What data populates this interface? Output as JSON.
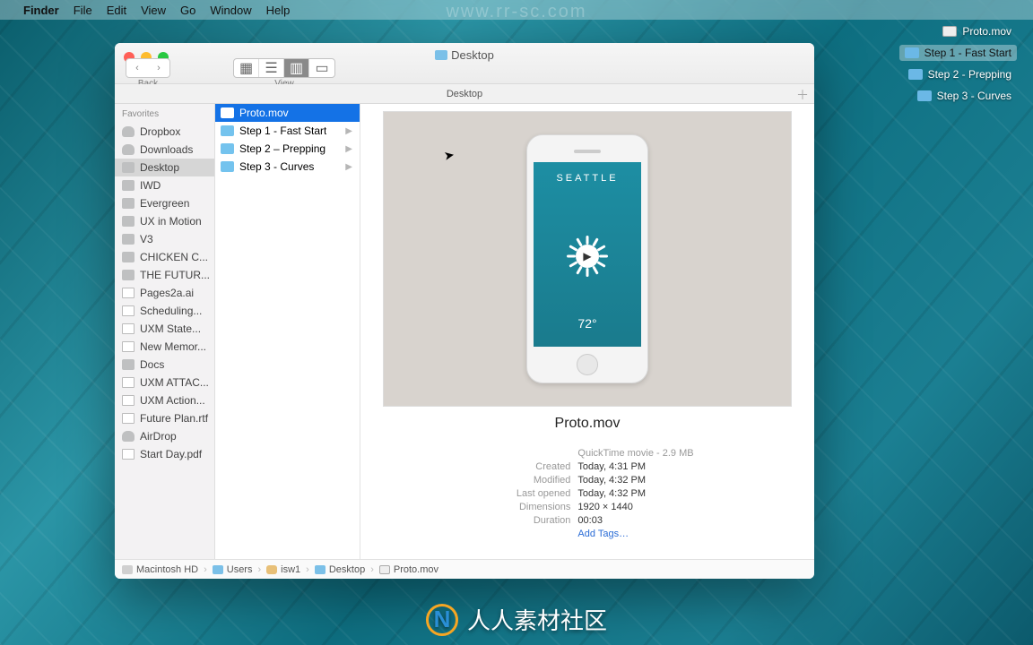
{
  "menubar": {
    "app": "Finder",
    "items": [
      "File",
      "Edit",
      "View",
      "Go",
      "Window",
      "Help"
    ]
  },
  "desktop_icons": [
    {
      "label": "Proto.mov",
      "type": "mov",
      "selected": false
    },
    {
      "label": "Step 1 - Fast Start",
      "type": "fld",
      "selected": true
    },
    {
      "label": "Step 2 - Prepping",
      "type": "fld",
      "selected": false
    },
    {
      "label": "Step 3 - Curves",
      "type": "fld",
      "selected": false
    }
  ],
  "window": {
    "title": "Desktop",
    "back_label": "Back",
    "view_label": "View",
    "tab": "Desktop"
  },
  "sidebar": {
    "header": "Favorites",
    "items": [
      {
        "label": "Dropbox",
        "icon": "cloud"
      },
      {
        "label": "Downloads",
        "icon": "cloud"
      },
      {
        "label": "Desktop",
        "icon": "fld",
        "selected": true
      },
      {
        "label": "IWD",
        "icon": "fld"
      },
      {
        "label": "Evergreen",
        "icon": "fld"
      },
      {
        "label": "UX in Motion",
        "icon": "fld"
      },
      {
        "label": "V3",
        "icon": "fld"
      },
      {
        "label": "CHICKEN C...",
        "icon": "fld"
      },
      {
        "label": "THE FUTUR...",
        "icon": "fld"
      },
      {
        "label": "Pages2a.ai",
        "icon": "doc"
      },
      {
        "label": "Scheduling...",
        "icon": "doc"
      },
      {
        "label": "UXM State...",
        "icon": "doc"
      },
      {
        "label": "New Memor...",
        "icon": "doc"
      },
      {
        "label": "Docs",
        "icon": "fld"
      },
      {
        "label": "UXM ATTAC...",
        "icon": "doc"
      },
      {
        "label": "UXM Action...",
        "icon": "doc"
      },
      {
        "label": "Future Plan.rtf",
        "icon": "doc"
      },
      {
        "label": "AirDrop",
        "icon": "cloud"
      },
      {
        "label": "Start Day.pdf",
        "icon": "doc"
      }
    ]
  },
  "column1": [
    {
      "label": "Proto.mov",
      "icon": "mov",
      "selected": true,
      "children": false
    },
    {
      "label": "Step 1 - Fast Start",
      "icon": "fld",
      "children": true
    },
    {
      "label": "Step 2 – Prepping",
      "icon": "fld",
      "children": true
    },
    {
      "label": "Step 3 - Curves",
      "icon": "fld",
      "children": true
    }
  ],
  "preview": {
    "city": "SEATTLE",
    "temp": "72°",
    "filename": "Proto.mov",
    "file_type": "QuickTime movie - 2.9 MB",
    "rows": [
      {
        "k": "Created",
        "v": "Today, 4:31 PM"
      },
      {
        "k": "Modified",
        "v": "Today, 4:32 PM"
      },
      {
        "k": "Last opened",
        "v": "Today, 4:32 PM"
      },
      {
        "k": "Dimensions",
        "v": "1920 × 1440"
      },
      {
        "k": "Duration",
        "v": "00:03"
      }
    ],
    "add_tags": "Add Tags…"
  },
  "pathbar": [
    {
      "label": "Macintosh HD",
      "icon": "hd"
    },
    {
      "label": "Users",
      "icon": "fld"
    },
    {
      "label": "isw1",
      "icon": "usr"
    },
    {
      "label": "Desktop",
      "icon": "fld"
    },
    {
      "label": "Proto.mov",
      "icon": "mov"
    }
  ],
  "watermark": {
    "url": "www.rr-sc.com",
    "footer": "人人素材社区"
  }
}
